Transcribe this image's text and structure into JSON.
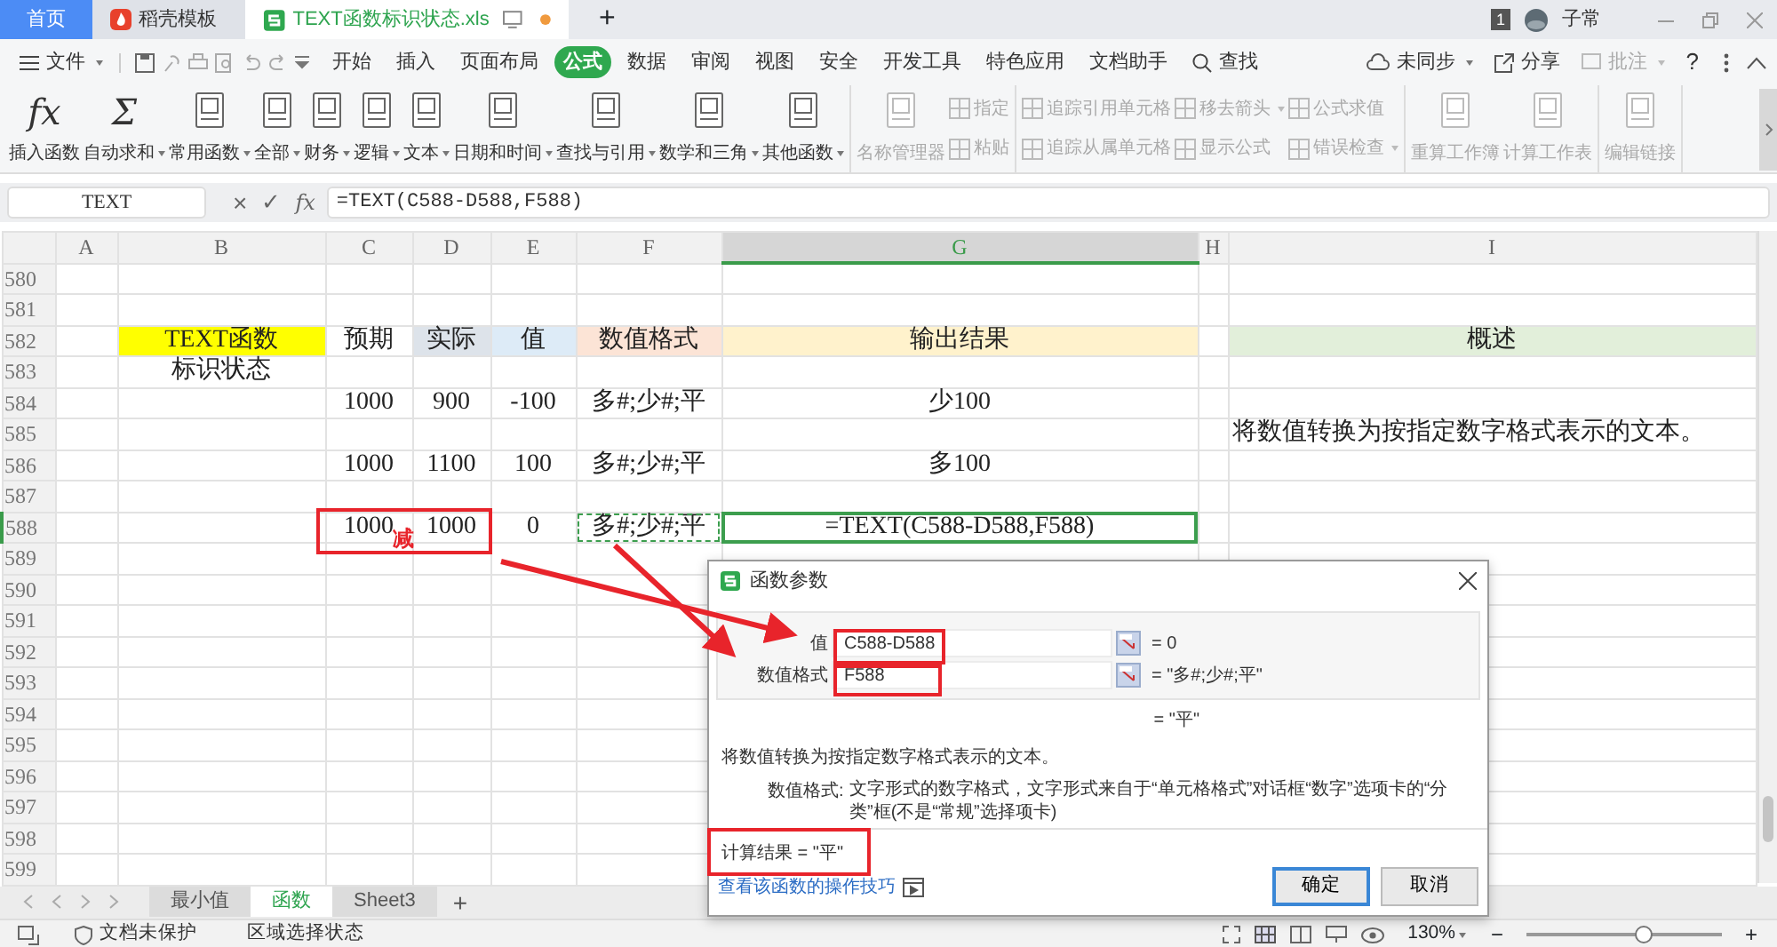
{
  "tabs": [
    {
      "label": "首页",
      "kind": "home",
      "selected": false
    },
    {
      "label": "稻壳模板",
      "kind": "docer",
      "selected": false
    },
    {
      "label": "TEXT函数标识状态.xls",
      "kind": "sheet",
      "selected": true,
      "unsaved": true
    }
  ],
  "tab_add": "+",
  "account": {
    "notifications": "1",
    "user": "子常"
  },
  "menu": {
    "file": "文件",
    "tabs": [
      {
        "label": "开始",
        "selected": false
      },
      {
        "label": "插入",
        "selected": false
      },
      {
        "label": "页面布局",
        "selected": false
      },
      {
        "label": "公式",
        "selected": true
      },
      {
        "label": "数据",
        "selected": false
      },
      {
        "label": "审阅",
        "selected": false
      },
      {
        "label": "视图",
        "selected": false
      },
      {
        "label": "安全",
        "selected": false
      },
      {
        "label": "开发工具",
        "selected": false
      },
      {
        "label": "特色应用",
        "selected": false
      },
      {
        "label": "文档助手",
        "selected": false
      }
    ],
    "search": "查找",
    "sync": "未同步",
    "share": "分享",
    "comment": "批注",
    "help": "?"
  },
  "ribbon": [
    {
      "items": [
        {
          "label": "插入函数",
          "kind": "big",
          "glyph": "fx",
          "dropdown": false,
          "disabled": false
        },
        {
          "label": "自动求和",
          "kind": "big",
          "glyph": "Σ",
          "dropdown": true,
          "disabled": false
        },
        {
          "label": "常用函数",
          "kind": "big",
          "dropdown": true,
          "disabled": false
        },
        {
          "label": "全部",
          "kind": "big",
          "dropdown": true,
          "disabled": false
        },
        {
          "label": "财务",
          "kind": "big",
          "dropdown": true,
          "disabled": false
        },
        {
          "label": "逻辑",
          "kind": "big",
          "dropdown": true,
          "disabled": false
        },
        {
          "label": "文本",
          "kind": "big",
          "dropdown": true,
          "disabled": false
        },
        {
          "label": "日期和时间",
          "kind": "big",
          "dropdown": true,
          "disabled": false
        },
        {
          "label": "查找与引用",
          "kind": "big",
          "dropdown": true,
          "disabled": false
        },
        {
          "label": "数学和三角",
          "kind": "big",
          "dropdown": true,
          "disabled": false
        },
        {
          "label": "其他函数",
          "kind": "big",
          "dropdown": true,
          "disabled": false
        }
      ]
    },
    {
      "items": [
        {
          "label": "名称管理器",
          "kind": "big",
          "dropdown": false,
          "disabled": true
        },
        {
          "label": "指定",
          "kind": "small",
          "dropdown": false,
          "disabled": true
        },
        {
          "label": "粘贴",
          "kind": "small",
          "dropdown": false,
          "disabled": true
        }
      ]
    },
    {
      "items": [
        {
          "label": "追踪引用单元格",
          "kind": "small",
          "dropdown": false,
          "disabled": true
        },
        {
          "label": "追踪从属单元格",
          "kind": "small",
          "dropdown": false,
          "disabled": true
        },
        {
          "label": "移去箭头",
          "kind": "small",
          "dropdown": true,
          "disabled": true
        },
        {
          "label": "显示公式",
          "kind": "small",
          "dropdown": false,
          "disabled": true
        },
        {
          "label": "公式求值",
          "kind": "small",
          "dropdown": false,
          "disabled": true
        },
        {
          "label": "错误检查",
          "kind": "small",
          "dropdown": true,
          "disabled": true
        }
      ]
    },
    {
      "items": [
        {
          "label": "重算工作簿",
          "kind": "big",
          "dropdown": false,
          "disabled": true
        },
        {
          "label": "计算工作表",
          "kind": "big",
          "dropdown": false,
          "disabled": true
        }
      ]
    },
    {
      "items": [
        {
          "label": "编辑链接",
          "kind": "big",
          "dropdown": false,
          "disabled": true
        }
      ]
    }
  ],
  "formula_bar": {
    "name_box": "TEXT",
    "cancel": "×",
    "enter": "✓",
    "fx": "fx",
    "formula": "=TEXT(C588-D588,F588)"
  },
  "columns": [
    {
      "label": "A",
      "selected": false
    },
    {
      "label": "B",
      "selected": false
    },
    {
      "label": "C",
      "selected": false
    },
    {
      "label": "D",
      "selected": false
    },
    {
      "label": "E",
      "selected": false
    },
    {
      "label": "F",
      "selected": false
    },
    {
      "label": "G",
      "selected": true
    },
    {
      "label": "H",
      "selected": false
    },
    {
      "label": "I",
      "selected": false
    }
  ],
  "rows": [
    {
      "number": "580",
      "selected": false
    },
    {
      "number": "581",
      "selected": false
    },
    {
      "number": "582",
      "selected": false,
      "cells": {
        "B": {
          "text": "TEXT函数",
          "color": "#ffff00"
        },
        "C": {
          "text": "预期"
        },
        "D": {
          "text": "实际",
          "color": "#dde3ea"
        },
        "E": {
          "text": "值",
          "color": "#ddebf7"
        },
        "F": {
          "text": "数值格式",
          "color": "#fce4d6"
        },
        "G": {
          "text": "输出结果",
          "color": "#fff2cc"
        },
        "I": {
          "text": "概述",
          "color": "#e2efda"
        }
      }
    },
    {
      "number": "583",
      "selected": false,
      "cells": {
        "B": {
          "text": "标识状态"
        }
      }
    },
    {
      "number": "584",
      "selected": false,
      "cells": {
        "C": {
          "text": "1000"
        },
        "D": {
          "text": "900"
        },
        "E": {
          "text": "-100"
        },
        "F": {
          "text": "多#;少#;平"
        },
        "G": {
          "text": "少100"
        }
      }
    },
    {
      "number": "585",
      "selected": false,
      "cells": {
        "I": {
          "text": "将数值转换为按指定数字格式表示的文本。",
          "left_aligned": true
        }
      }
    },
    {
      "number": "586",
      "selected": false,
      "cells": {
        "C": {
          "text": "1000"
        },
        "D": {
          "text": "1100"
        },
        "E": {
          "text": "100"
        },
        "F": {
          "text": "多#;少#;平"
        },
        "G": {
          "text": "多100"
        }
      }
    },
    {
      "number": "587",
      "selected": false
    },
    {
      "number": "588",
      "selected": true,
      "cells": {
        "C": {
          "text": "1000"
        },
        "D": {
          "text": "1000"
        },
        "E": {
          "text": "0"
        },
        "F": {
          "text": "多#;少#;平",
          "referenced": true
        },
        "G": {
          "text": "=TEXT(C588-D588,F588)",
          "active": true
        }
      }
    },
    {
      "number": "589",
      "selected": false
    },
    {
      "number": "590",
      "selected": false
    },
    {
      "number": "591",
      "selected": false
    },
    {
      "number": "592",
      "selected": false
    },
    {
      "number": "593",
      "selected": false
    },
    {
      "number": "594",
      "selected": false
    },
    {
      "number": "595",
      "selected": false
    },
    {
      "number": "596",
      "selected": false
    },
    {
      "number": "597",
      "selected": false
    },
    {
      "number": "598",
      "selected": false
    },
    {
      "number": "599",
      "selected": false
    }
  ],
  "annotation_note": "减",
  "dialog": {
    "title": "函数参数",
    "args": [
      {
        "label": "值",
        "value": "C588-D588",
        "result": "= 0"
      },
      {
        "label": "数值格式",
        "value": "F588",
        "result": "= \"多#;少#;平\""
      }
    ],
    "formula_result": "= \"平\"",
    "description": "将数值转换为按指定数字格式表示的文本。",
    "arg_help_label": "数值格式:",
    "arg_help": "文字形式的数字格式，文字形式来自于“单元格格式”对话框“数字”选项卡的“分类”框(不是“常规”选择项卡)",
    "result": "计算结果 = \"平\"",
    "link": "查看该函数的操作技巧",
    "buttons": [
      {
        "label": "确定",
        "default": true
      },
      {
        "label": "取消",
        "default": false
      }
    ]
  },
  "sheet_tabs": [
    {
      "label": "最小值",
      "selected": false
    },
    {
      "label": "函数",
      "selected": true
    },
    {
      "label": "Sheet3",
      "selected": false
    }
  ],
  "sheet_add": "+",
  "status_bar": {
    "protect": "文档未保护",
    "selection": "区域选择状态",
    "zoom": "130%",
    "zoom_out": "−",
    "zoom_in": "+",
    "level": 0.6
  }
}
